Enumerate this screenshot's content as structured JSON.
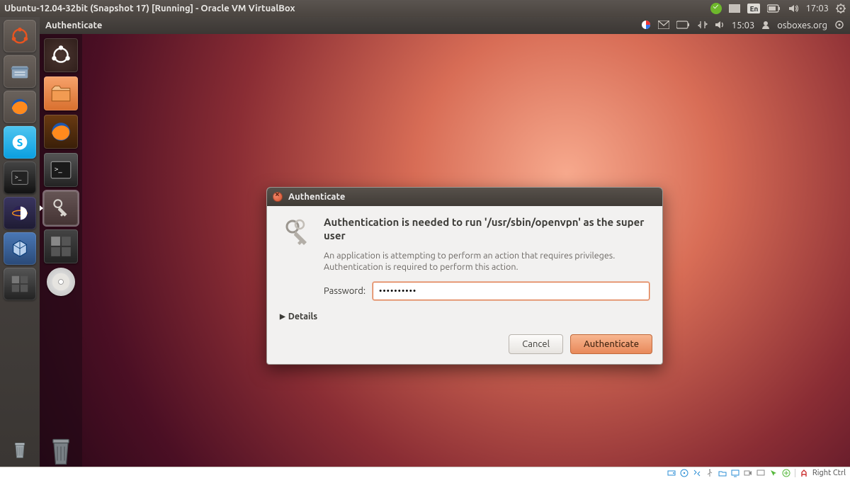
{
  "host": {
    "window_title": "Ubuntu-12.04-32bit (Snapshot 17) [Running] - Oracle VM VirtualBox",
    "lang": "En",
    "time": "17:03",
    "status_key": "Right Ctrl"
  },
  "guest": {
    "app_title": "Authenticate",
    "time": "15:03",
    "user": "osboxes.org"
  },
  "dialog": {
    "title": "Authenticate",
    "heading": "Authentication is needed to run '/usr/sbin/openvpn' as the super user",
    "message": "An application is attempting to perform an action that requires privileges. Authentication is required to perform this action.",
    "password_label": "Password:",
    "password_value": "••••••••••",
    "details_label": "Details",
    "cancel": "Cancel",
    "authenticate": "Authenticate"
  },
  "host_launcher": [
    {
      "name": "dash-icon"
    },
    {
      "name": "files-icon"
    },
    {
      "name": "firefox-icon"
    },
    {
      "name": "skype-icon"
    },
    {
      "name": "terminal-icon"
    },
    {
      "name": "eclipse-icon"
    },
    {
      "name": "virtualbox-icon"
    },
    {
      "name": "workspace-icon"
    }
  ],
  "guest_launcher": [
    {
      "name": "dash-icon"
    },
    {
      "name": "files-icon"
    },
    {
      "name": "firefox-icon"
    },
    {
      "name": "terminal-icon"
    },
    {
      "name": "keyring-icon"
    },
    {
      "name": "workspace-icon"
    },
    {
      "name": "disc-icon"
    }
  ]
}
